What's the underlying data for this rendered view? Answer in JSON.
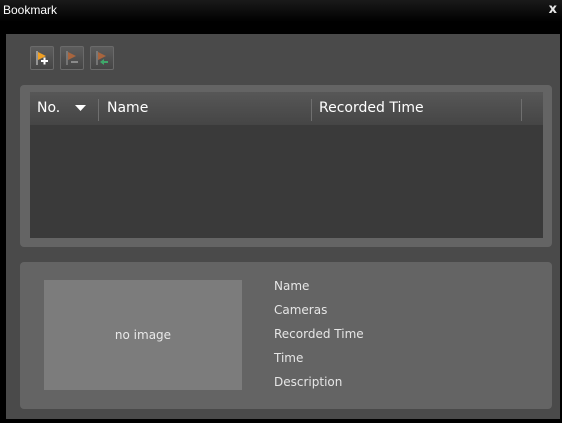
{
  "window": {
    "title": "Bookmark",
    "close_label": "x"
  },
  "toolbar": {
    "buttons": [
      {
        "icon": "add-bookmark-icon"
      },
      {
        "icon": "edit-bookmark-icon"
      },
      {
        "icon": "delete-bookmark-icon"
      }
    ]
  },
  "table": {
    "columns": [
      "No.",
      "Name",
      "Recorded Time"
    ],
    "rows": []
  },
  "details": {
    "thumbnail_text": "no image",
    "fields": [
      "Name",
      "Cameras",
      "Recorded Time",
      "Time",
      "Description"
    ]
  },
  "colors": {
    "flag_active": "#f0a024",
    "flag_disabled": "#a8653e",
    "plus": "#ffffff",
    "arrow": "#3fa86a"
  }
}
